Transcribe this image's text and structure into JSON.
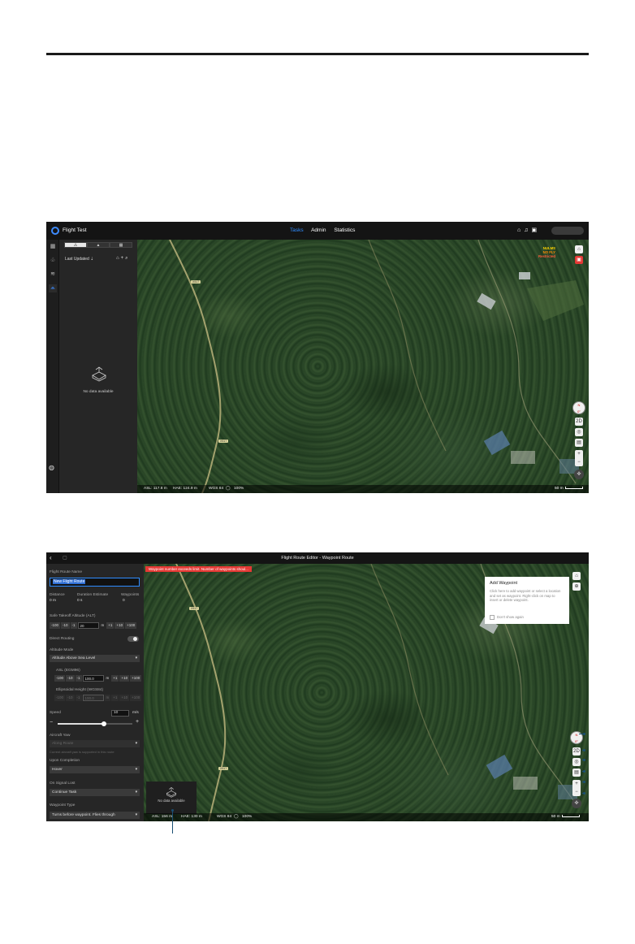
{
  "shot1": {
    "app_title": "Flight Test",
    "nav": [
      "Tasks",
      "Admin",
      "Statistics"
    ],
    "active_nav": "Tasks",
    "tabs": [
      "⚠",
      "▲",
      "▦"
    ],
    "last_updated": "Last Updated ⇣",
    "no_data": "No data available",
    "status": {
      "asl": "ASL: 117.8 m",
      "hae": "HAE: 124.9 m",
      "coord": "WGS 84",
      "pct": "100%"
    },
    "scale": "50 m",
    "nofly": [
      "NULMS",
      "NO FLY",
      "Restricted"
    ],
    "road_labels": [
      "X517",
      "X517"
    ],
    "colors": {
      "accent": "#2f8cff",
      "warning": "#e53935"
    }
  },
  "shot2": {
    "title": "Flight Route Editor - Waypoint Route",
    "route_name_label": "Flight Route Name",
    "route_name_value": "New Flight Route",
    "stats": [
      {
        "label": "Distance",
        "value": "0 m"
      },
      {
        "label": "Duration Estimate",
        "value": "0 s"
      },
      {
        "label": "Waypoints",
        "value": "0"
      }
    ],
    "safe_takeoff_label": "Safe Takeoff Altitude (ALT)",
    "safe_takeoff_value": "20",
    "steps_minus": [
      "-100",
      "-10",
      "-1"
    ],
    "steps_plus": [
      "+1",
      "+10",
      "+100"
    ],
    "unit_m": "m",
    "direct_routing_label": "Direct Routing",
    "altitude_mode_label": "Altitude Mode",
    "altitude_mode_value": "Altitude Above Sea Level",
    "asl_label": "ASL (EGM96)",
    "asl_value": "100.0",
    "ellipsoid_label": "Ellipsoidal Height (WGS84)",
    "ellipsoid_value": "100.0",
    "speed_label": "Speed",
    "speed_value": "10",
    "speed_unit": "m/s",
    "speed_fraction": 0.62,
    "aircraft_yaw_label": "Aircraft Yaw",
    "aircraft_yaw_value": "Along Route",
    "aircraft_yaw_note": "Current aircraft yaw is supported in this route",
    "upon_completion_label": "Upon Completion",
    "upon_completion_value": "Hover",
    "on_signal_lost_label": "On Signal Lost",
    "on_signal_lost_value": "Continue Task",
    "waypoint_type_label": "Waypoint Type",
    "waypoint_type_value": "Turns before waypoint. Flies through",
    "warning": "Waypoint number exceeds limit. Number of waypoints shoul...",
    "popup_title": "Add Waypoint",
    "popup_body": "Click here to add waypoint or select a location and set as waypoint. Right-click on map to insert or delete waypoint.",
    "popup_check": "Don't show again",
    "no_data": "No data available",
    "status": {
      "asl": "ASL: 156 m",
      "hae": "HAE: 130 m",
      "coord": "WGS 84",
      "pct": "100%"
    },
    "scale": "50 m",
    "road_labels": [
      "X517",
      "X517"
    ]
  }
}
